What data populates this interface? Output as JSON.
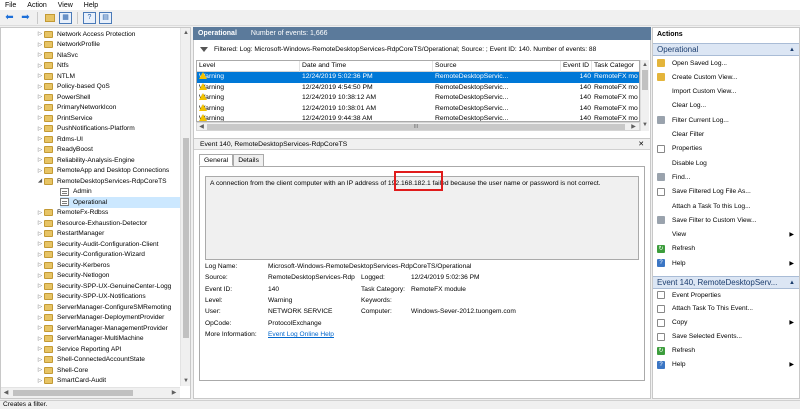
{
  "menu": [
    "File",
    "Action",
    "View",
    "Help"
  ],
  "toolbar": {
    "icons": [
      "back-arrow-icon",
      "forward-arrow-icon",
      "folder-up-icon",
      "show-hide-tree-icon",
      "help-icon",
      "properties-icon"
    ]
  },
  "tree": {
    "items": [
      {
        "label": "Network Access Protection",
        "type": "folder",
        "expander": "▷"
      },
      {
        "label": "NetworkProfile",
        "type": "folder",
        "expander": "▷"
      },
      {
        "label": "NlaSvc",
        "type": "folder",
        "expander": "▷"
      },
      {
        "label": "Ntfs",
        "type": "folder",
        "expander": "▷"
      },
      {
        "label": "NTLM",
        "type": "folder",
        "expander": "▷"
      },
      {
        "label": "Policy-based QoS",
        "type": "folder",
        "expander": "▷"
      },
      {
        "label": "PowerShell",
        "type": "folder",
        "expander": "▷"
      },
      {
        "label": "PrimaryNetworkIcon",
        "type": "folder",
        "expander": "▷"
      },
      {
        "label": "PrintService",
        "type": "folder",
        "expander": "▷"
      },
      {
        "label": "PushNotifications-Platform",
        "type": "folder",
        "expander": "▷"
      },
      {
        "label": "Rdms-UI",
        "type": "folder",
        "expander": "▷"
      },
      {
        "label": "ReadyBoost",
        "type": "folder",
        "expander": "▷"
      },
      {
        "label": "Reliability-Analysis-Engine",
        "type": "folder",
        "expander": "▷"
      },
      {
        "label": "RemoteApp and Desktop Connections",
        "type": "folder",
        "expander": "▷"
      },
      {
        "label": "RemoteDesktopServices-RdpCoreTS",
        "type": "folder",
        "expander": "◢"
      },
      {
        "label": "Admin",
        "type": "log",
        "expander": "",
        "indent": 1
      },
      {
        "label": "Operational",
        "type": "log",
        "expander": "",
        "indent": 1,
        "selected": true
      },
      {
        "label": "RemoteFx-Rdbss",
        "type": "folder",
        "expander": "▷"
      },
      {
        "label": "Resource-Exhaustion-Detector",
        "type": "folder",
        "expander": "▷"
      },
      {
        "label": "RestartManager",
        "type": "folder",
        "expander": "▷"
      },
      {
        "label": "Security-Audit-Configuration-Client",
        "type": "folder",
        "expander": "▷"
      },
      {
        "label": "Security-Configuration-Wizard",
        "type": "folder",
        "expander": "▷"
      },
      {
        "label": "Security-Kerberos",
        "type": "folder",
        "expander": "▷"
      },
      {
        "label": "Security-Netlogon",
        "type": "folder",
        "expander": "▷"
      },
      {
        "label": "Security-SPP-UX-GenuineCenter-Logg",
        "type": "folder",
        "expander": "▷"
      },
      {
        "label": "Security-SPP-UX-Notifications",
        "type": "folder",
        "expander": "▷"
      },
      {
        "label": "ServerManager-ConfigureSMRemoting",
        "type": "folder",
        "expander": "▷"
      },
      {
        "label": "ServerManager-DeploymentProvider",
        "type": "folder",
        "expander": "▷"
      },
      {
        "label": "ServerManager-ManagementProvider",
        "type": "folder",
        "expander": "▷"
      },
      {
        "label": "ServerManager-MultiMachine",
        "type": "folder",
        "expander": "▷"
      },
      {
        "label": "Service Reporting API",
        "type": "folder",
        "expander": "▷"
      },
      {
        "label": "Shell-ConnectedAccountState",
        "type": "folder",
        "expander": "▷"
      },
      {
        "label": "Shell-Core",
        "type": "folder",
        "expander": "▷"
      },
      {
        "label": "SmartCard-Audit",
        "type": "folder",
        "expander": "▷"
      }
    ]
  },
  "center": {
    "title": "Operational",
    "count_text": "Number of events: 1,666",
    "filter_text": "Filtered: Log: Microsoft-Windows-RemoteDesktopServices-RdpCoreTS/Operational; Source: ; Event ID: 140. Number of events: 88",
    "columns": [
      "Level",
      "Date and Time",
      "Source",
      "Event ID",
      "Task Categor"
    ],
    "rows": [
      {
        "level": "Warning",
        "date": "12/24/2019 5:02:36 PM",
        "source": "RemoteDesktopServic...",
        "id": "140",
        "task": "RemoteFX mo",
        "selected": true
      },
      {
        "level": "Warning",
        "date": "12/24/2019 4:54:50 PM",
        "source": "RemoteDesktopServic...",
        "id": "140",
        "task": "RemoteFX mo"
      },
      {
        "level": "Warning",
        "date": "12/24/2019 10:38:12 AM",
        "source": "RemoteDesktopServic...",
        "id": "140",
        "task": "RemoteFX mo"
      },
      {
        "level": "Warning",
        "date": "12/24/2019 10:38:01 AM",
        "source": "RemoteDesktopServic...",
        "id": "140",
        "task": "RemoteFX mo"
      },
      {
        "level": "Warning",
        "date": "12/24/2019 9:44:38 AM",
        "source": "RemoteDesktopServic...",
        "id": "140",
        "task": "RemoteFX mo"
      }
    ],
    "hscroll_grip": "III"
  },
  "detail": {
    "title": "Event 140, RemoteDesktopServices-RdpCoreTS",
    "close": "✕",
    "tabs": [
      "General",
      "Details"
    ],
    "message": "A connection from the client computer with an IP address of 192.168.182.1 failed because the user name or password is not correct.",
    "props": {
      "log_name_label": "Log Name:",
      "log_name": "Microsoft-Windows-RemoteDesktopServices-RdpCoreTS/Operational",
      "source_label": "Source:",
      "source": "RemoteDesktopServices-Rdp",
      "logged_label": "Logged:",
      "logged": "12/24/2019 5:02:36 PM",
      "event_id_label": "Event ID:",
      "event_id": "140",
      "task_label": "Task Category:",
      "task": "RemoteFX module",
      "level_label": "Level:",
      "level": "Warning",
      "keywords_label": "Keywords:",
      "keywords": "",
      "user_label": "User:",
      "user": "NETWORK SERVICE",
      "computer_label": "Computer:",
      "computer": "Windows-Sever-2012.tuongem.com",
      "opcode_label": "OpCode:",
      "opcode": "ProtocolExchange",
      "more_info_label": "More Information:",
      "more_info_link": "Event Log Online Help"
    }
  },
  "actions": {
    "header": "Actions",
    "section1": {
      "title": "Operational",
      "arrow": "▲"
    },
    "items1": [
      {
        "label": "Open Saved Log...",
        "icon": "open-log-icon",
        "style": "yel"
      },
      {
        "label": "Create Custom View...",
        "icon": "create-view-icon",
        "style": "yel"
      },
      {
        "label": "Import Custom View...",
        "icon": "import-view-icon",
        "style": "none"
      },
      {
        "label": "Clear Log...",
        "icon": "clear-log-icon",
        "style": "none"
      },
      {
        "label": "Filter Current Log...",
        "icon": "filter-icon",
        "style": "gray"
      },
      {
        "label": "Clear Filter",
        "icon": "clear-filter-icon",
        "style": "none"
      },
      {
        "label": "Properties",
        "icon": "properties-icon",
        "style": "doc"
      },
      {
        "label": "Disable Log",
        "icon": "disable-log-icon",
        "style": "none"
      },
      {
        "label": "Find...",
        "icon": "find-icon",
        "style": "gray"
      },
      {
        "label": "Save Filtered Log File As...",
        "icon": "save-icon",
        "style": "doc"
      },
      {
        "label": "Attach a Task To this Log...",
        "icon": "attach-task-icon",
        "style": "none"
      },
      {
        "label": "Save Filter to Custom View...",
        "icon": "save-filter-icon",
        "style": "gray"
      },
      {
        "label": "View",
        "icon": "view-icon",
        "style": "none",
        "submenu": true
      },
      {
        "label": "Refresh",
        "icon": "refresh-icon",
        "style": "grn"
      },
      {
        "label": "Help",
        "icon": "help-icon",
        "style": "blue",
        "submenu": true
      }
    ],
    "section2": {
      "title": "Event 140, RemoteDesktopServ...",
      "arrow": "▲"
    },
    "items2": [
      {
        "label": "Event Properties",
        "icon": "event-properties-icon",
        "style": "doc"
      },
      {
        "label": "Attach Task To This Event...",
        "icon": "attach-event-task-icon",
        "style": "doc"
      },
      {
        "label": "Copy",
        "icon": "copy-icon",
        "style": "doc",
        "submenu": true
      },
      {
        "label": "Save Selected Events...",
        "icon": "save-events-icon",
        "style": "doc"
      },
      {
        "label": "Refresh",
        "icon": "refresh-icon",
        "style": "grn"
      },
      {
        "label": "Help",
        "icon": "help-icon",
        "style": "blue",
        "submenu": true
      }
    ]
  },
  "status": "Creates a filter.",
  "colors": {
    "accent": "#0078d7",
    "header": "#5b7a9b",
    "highlight": "#e01b1b"
  }
}
